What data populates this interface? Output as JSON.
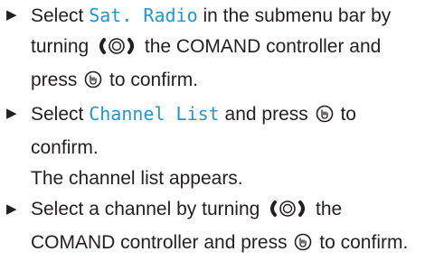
{
  "steps": [
    {
      "parts": {
        "a": "Select ",
        "b": "Sat. Radio",
        "c": " in the submenu bar by turning ",
        "d": " the COMAND controller and press ",
        "e": " to confirm."
      }
    },
    {
      "parts": {
        "a": "Select ",
        "b": "Channel List",
        "c": " and press ",
        "d": " to confirm."
      }
    },
    {
      "parts": {
        "a": "Select a channel by turning ",
        "b": " the COMAND controller and press ",
        "c": " to confirm."
      }
    }
  ],
  "note": "The channel list appears.",
  "icons": {
    "bullet": "right-triangle-icon",
    "turn": "controller-turn-icon",
    "press": "controller-press-icon"
  },
  "colors": {
    "text": "#231f20",
    "menu_item": "#2196d3"
  }
}
